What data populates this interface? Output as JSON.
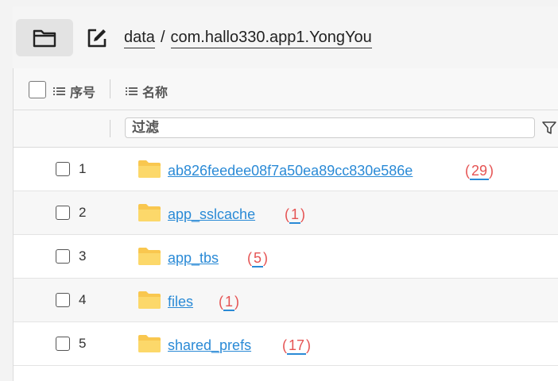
{
  "path": {
    "segments": [
      "data",
      "com.hallo330.app1.YongYou"
    ],
    "separator": "/"
  },
  "header": {
    "index_label": "序号",
    "name_label": "名称"
  },
  "filter": {
    "placeholder": "过滤"
  },
  "rows": [
    {
      "index": "1",
      "name": "ab826feedee08f7a50ea89cc830e586e",
      "count": "29"
    },
    {
      "index": "2",
      "name": "app_sslcache",
      "count": "1"
    },
    {
      "index": "3",
      "name": "app_tbs",
      "count": "5"
    },
    {
      "index": "4",
      "name": "files",
      "count": "1"
    },
    {
      "index": "5",
      "name": "shared_prefs",
      "count": "17"
    }
  ],
  "colors": {
    "link": "#2a8ad6",
    "count": "#e55353",
    "folder": "#f9c74f"
  },
  "icons": {
    "open_folder": "folder-icon",
    "edit_path": "edit-icon",
    "column_list": "list-icon",
    "filter": "filter-icon",
    "row_folder": "folder-icon"
  }
}
